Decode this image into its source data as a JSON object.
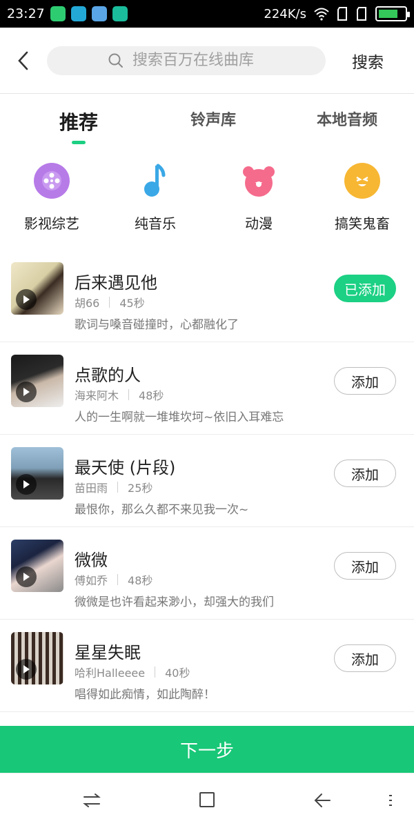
{
  "status_bar": {
    "time": "23:27",
    "network_speed": "224K/s",
    "app_icons": [
      {
        "name": "green-app-icon",
        "color": "#2ecc71"
      },
      {
        "name": "blue-swirl-app-icon",
        "color": "#23a8d6"
      },
      {
        "name": "gallery-app-icon",
        "color": "#5aa5e6"
      },
      {
        "name": "usb-icon",
        "color": "#1abc9c"
      }
    ],
    "battery_level": 0.75
  },
  "header": {
    "back_icon": "back-arrow-icon",
    "search_placeholder": "搜索百万在线曲库",
    "search_button": "搜索"
  },
  "tabs": [
    {
      "label": "推荐",
      "active": true
    },
    {
      "label": "铃声库",
      "active": false
    },
    {
      "label": "本地音频",
      "active": false
    }
  ],
  "categories": [
    {
      "label": "影视综艺",
      "icon": "film-reel-icon",
      "color": "#b77be8"
    },
    {
      "label": "纯音乐",
      "icon": "music-note-icon",
      "color": "#3aa8e6"
    },
    {
      "label": "动漫",
      "icon": "bear-icon",
      "color": "#f56b8c"
    },
    {
      "label": "搞笑鬼畜",
      "icon": "funny-face-icon",
      "color": "#f7b733"
    }
  ],
  "songs": [
    {
      "title": "后来遇见他",
      "artist": "胡66",
      "duration": "45秒",
      "desc": "歌词与嗓音碰撞时，心都融化了",
      "button": "已添加",
      "added": true
    },
    {
      "title": "点歌的人",
      "artist": "海来阿木",
      "duration": "48秒",
      "desc": "人的一生啊就一堆堆坎坷~依旧入耳难忘",
      "button": "添加",
      "added": false
    },
    {
      "title": "最天使 (片段)",
      "artist": "苗田雨",
      "duration": "25秒",
      "desc": "最恨你，那么久都不来见我一次~",
      "button": "添加",
      "added": false
    },
    {
      "title": "微微",
      "artist": "傅如乔",
      "duration": "48秒",
      "desc": "微微是也许看起来渺小，却强大的我们",
      "button": "添加",
      "added": false
    },
    {
      "title": "星星失眠",
      "artist": "哈利Halleeee",
      "duration": "40秒",
      "desc": "唱得如此痴情，如此陶醉！",
      "button": "添加",
      "added": false
    }
  ],
  "next_button": "下一步",
  "accent_color": "#1cd084"
}
